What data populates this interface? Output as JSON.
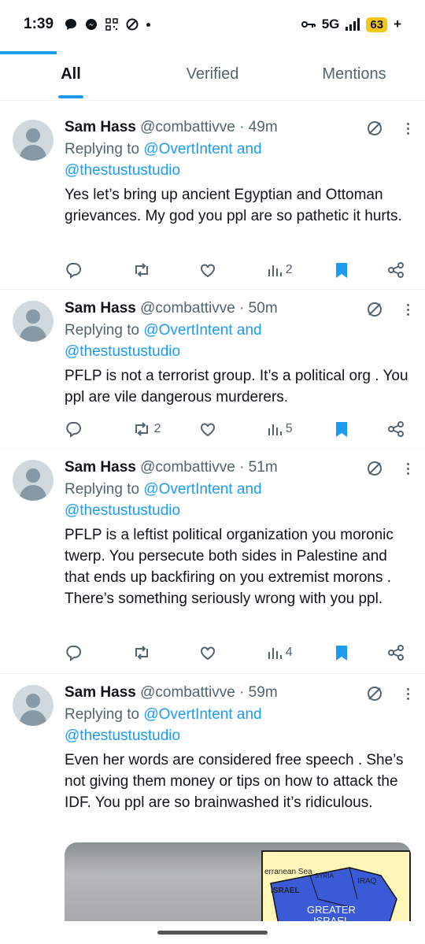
{
  "status_bar": {
    "time": "1:39",
    "network": "5G",
    "battery": "63",
    "battery_suffix": "+"
  },
  "tabs": [
    {
      "label": "All",
      "active": true
    },
    {
      "label": "Verified",
      "active": false
    },
    {
      "label": "Mentions",
      "active": false
    }
  ],
  "tweets": [
    {
      "name": "Sam Hass",
      "handle": "@combattivve",
      "time": "· 49m",
      "replying_prefix": "Replying to ",
      "replying_to_1": "@OvertIntent and",
      "replying_to_2": "@thestustustudio",
      "text": "Yes let’s bring up ancient Egyptian and Ottoman grievances. My god you ppl are so pathetic it hurts.",
      "retweets": "",
      "views": "2"
    },
    {
      "name": "Sam Hass",
      "handle": "@combattivve",
      "time": "· 50m",
      "replying_prefix": "Replying to ",
      "replying_to_1": "@OvertIntent and",
      "replying_to_2": "@thestustustudio",
      "text": "PFLP is not a terrorist group. It’s a political org . You ppl are vile dangerous murderers.",
      "retweets": "2",
      "views": "5"
    },
    {
      "name": "Sam Hass",
      "handle": "@combattivve",
      "time": "· 51m",
      "replying_prefix": "Replying to ",
      "replying_to_1": "@OvertIntent and",
      "replying_to_2": "@thestustustudio",
      "text": "PFLP is a leftist political organization you moronic twerp. You persecute both sides in Palestine and that ends up backfiring on you extremist morons . There’s something seriously wrong with you ppl.",
      "retweets": "",
      "views": "4"
    },
    {
      "name": "Sam Hass",
      "handle": "@combattivve",
      "time": "· 59m",
      "replying_prefix": "Replying to ",
      "replying_to_1": "@OvertIntent and",
      "replying_to_2": "@thestustustudio",
      "text": "Even her words are considered free speech . She’s not giving them money or tips on how to attack the IDF. You ppl are so brainwashed it’s ridiculous."
    }
  ],
  "media": {
    "map_labels": [
      "erranean Sea",
      "SYRIA",
      "ISRAEL",
      "IRAQ",
      "GREATER",
      "ISRAEL"
    ]
  },
  "colors": {
    "accent": "#1d9bf0",
    "secondary_text": "#536471",
    "battery": "#f5c518"
  }
}
